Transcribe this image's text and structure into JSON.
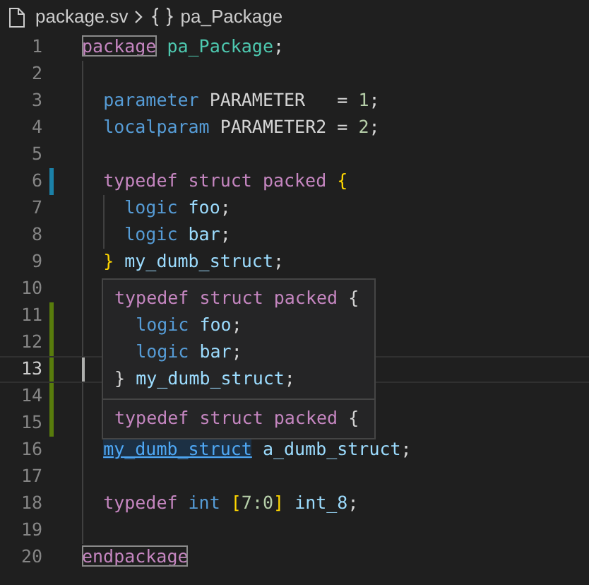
{
  "breadcrumb": {
    "file": "package.sv",
    "symbol": "pa_Package"
  },
  "lines": [
    {
      "number": "1",
      "current": false,
      "tokens": [
        {
          "text": "package",
          "kind": "keyword",
          "matched": true
        },
        {
          "text": " pa_Package",
          "kind": "type"
        },
        {
          "text": ";",
          "kind": "plain"
        }
      ]
    },
    {
      "number": "2",
      "current": false
    },
    {
      "number": "3",
      "current": false,
      "tokens": [
        {
          "text": "  parameter",
          "kind": "builtin"
        },
        {
          "text": " PARAMETER   = ",
          "kind": "plain"
        },
        {
          "text": "1",
          "kind": "number"
        },
        {
          "text": ";",
          "kind": "plain"
        }
      ]
    },
    {
      "number": "4",
      "current": false,
      "tokens": [
        {
          "text": "  localparam",
          "kind": "builtin"
        },
        {
          "text": " PARAMETER2 = ",
          "kind": "plain"
        },
        {
          "text": "2",
          "kind": "number"
        },
        {
          "text": ";",
          "kind": "plain"
        }
      ]
    },
    {
      "number": "5",
      "current": false
    },
    {
      "number": "6",
      "color": "#1b81a8",
      "current": false,
      "tokens": [
        {
          "text": "  typedef struct packed",
          "kind": "keyword"
        },
        {
          "text": " {",
          "kind": "brace"
        }
      ]
    },
    {
      "number": "7",
      "current": false,
      "tokens": [
        {
          "text": "    logic",
          "kind": "builtin"
        },
        {
          "text": " foo",
          "kind": "ident"
        },
        {
          "text": ";",
          "kind": "plain"
        }
      ]
    },
    {
      "number": "8",
      "current": false,
      "tokens": [
        {
          "text": "    logic",
          "kind": "builtin"
        },
        {
          "text": " bar",
          "kind": "ident"
        },
        {
          "text": ";",
          "kind": "plain"
        }
      ]
    },
    {
      "number": "9",
      "current": false,
      "tokens": [
        {
          "text": "  }",
          "kind": "brace"
        },
        {
          "text": " my_dumb_struct",
          "kind": "ident"
        },
        {
          "text": ";",
          "kind": "plain"
        }
      ]
    },
    {
      "number": "10",
      "current": false
    },
    {
      "number": "11",
      "color": "#587c0c",
      "current": false
    },
    {
      "number": "12",
      "color": "#587c0c",
      "current": false
    },
    {
      "number": "13",
      "color": "#587c0c",
      "current": true
    },
    {
      "number": "14",
      "color": "#587c0c",
      "current": false
    },
    {
      "number": "15",
      "color": "#587c0c",
      "current": false
    },
    {
      "number": "16",
      "current": false,
      "tokens": [
        {
          "text": "  my_dumb_struct",
          "kind": "link"
        },
        {
          "text": " a_dumb_struct",
          "kind": "ident"
        },
        {
          "text": ";",
          "kind": "plain"
        }
      ]
    },
    {
      "number": "17",
      "current": false
    },
    {
      "number": "18",
      "current": false,
      "tokens": [
        {
          "text": "  typedef",
          "kind": "keyword"
        },
        {
          "text": " int",
          "kind": "builtin"
        },
        {
          "text": " [",
          "kind": "brace"
        },
        {
          "text": "7:0",
          "kind": "number"
        },
        {
          "text": "]",
          "kind": "brace"
        },
        {
          "text": " int_8",
          "kind": "ident"
        },
        {
          "text": ";",
          "kind": "plain"
        }
      ]
    },
    {
      "number": "19",
      "current": false
    },
    {
      "number": "20",
      "current": false,
      "tokens": [
        {
          "text": "endpackage",
          "kind": "keyword",
          "matched": true
        }
      ]
    }
  ],
  "hover": {
    "sections": [
      {
        "lines": [
          [
            {
              "text": "typedef struct packed",
              "kind": "keyword"
            },
            {
              "text": " {",
              "kind": "plain"
            }
          ],
          [
            {
              "text": "  logic",
              "kind": "builtin"
            },
            {
              "text": " foo",
              "kind": "ident"
            },
            {
              "text": ";",
              "kind": "plain"
            }
          ],
          [
            {
              "text": "  logic",
              "kind": "builtin"
            },
            {
              "text": " bar",
              "kind": "ident"
            },
            {
              "text": ";",
              "kind": "plain"
            }
          ],
          [
            {
              "text": "}",
              "kind": "plain"
            },
            {
              "text": " my_dumb_struct",
              "kind": "ident"
            },
            {
              "text": ";",
              "kind": "plain"
            }
          ]
        ]
      },
      {
        "lines": [
          [
            {
              "text": "typedef struct packed",
              "kind": "keyword"
            },
            {
              "text": " {",
              "kind": "plain"
            }
          ]
        ]
      }
    ]
  }
}
